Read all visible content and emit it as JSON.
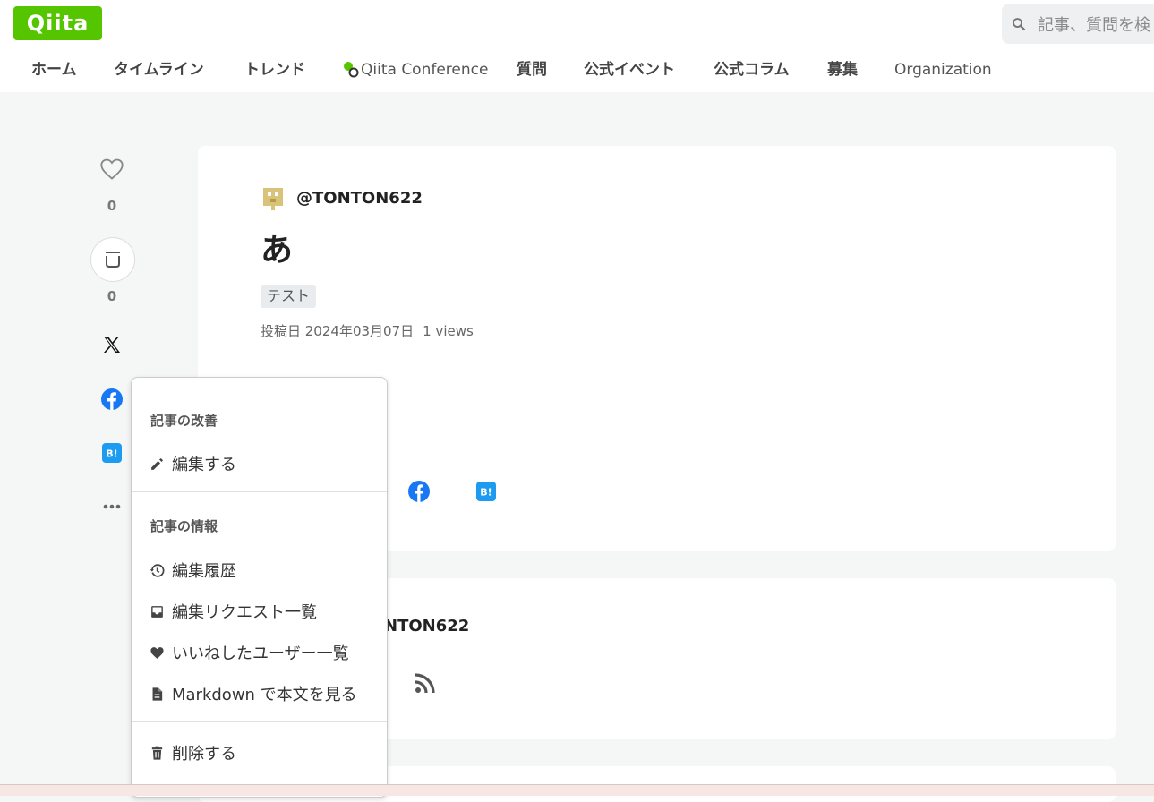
{
  "header": {
    "logo": "Qiita",
    "search_placeholder": "記事、質問を検"
  },
  "nav": {
    "home": "ホーム",
    "timeline": "タイムライン",
    "trend": "トレンド",
    "conference": "Qiita Conference",
    "questions": "質問",
    "events": "公式イベント",
    "columns": "公式コラム",
    "recruit": "募集",
    "organization": "Organization"
  },
  "rail": {
    "like_count": "0",
    "stock_count": "0"
  },
  "article": {
    "author": "@TONTON622",
    "title": "あ",
    "tag": "テスト",
    "posted_label": "投稿日 2024年03月07日",
    "views": "1 views"
  },
  "author_card": {
    "name_partial": "NTON622"
  },
  "menu": {
    "section1": "記事の改善",
    "edit": "編集する",
    "section2": "記事の情報",
    "history": "編集履歴",
    "edit_requests": "編集リクエスト一覧",
    "liked_users": "いいねしたユーザー一覧",
    "markdown": "Markdown で本文を見る",
    "delete": "削除する"
  },
  "colors": {
    "brand": "#55c500",
    "facebook": "#1877f2",
    "hatena": "#1d9bf0"
  }
}
